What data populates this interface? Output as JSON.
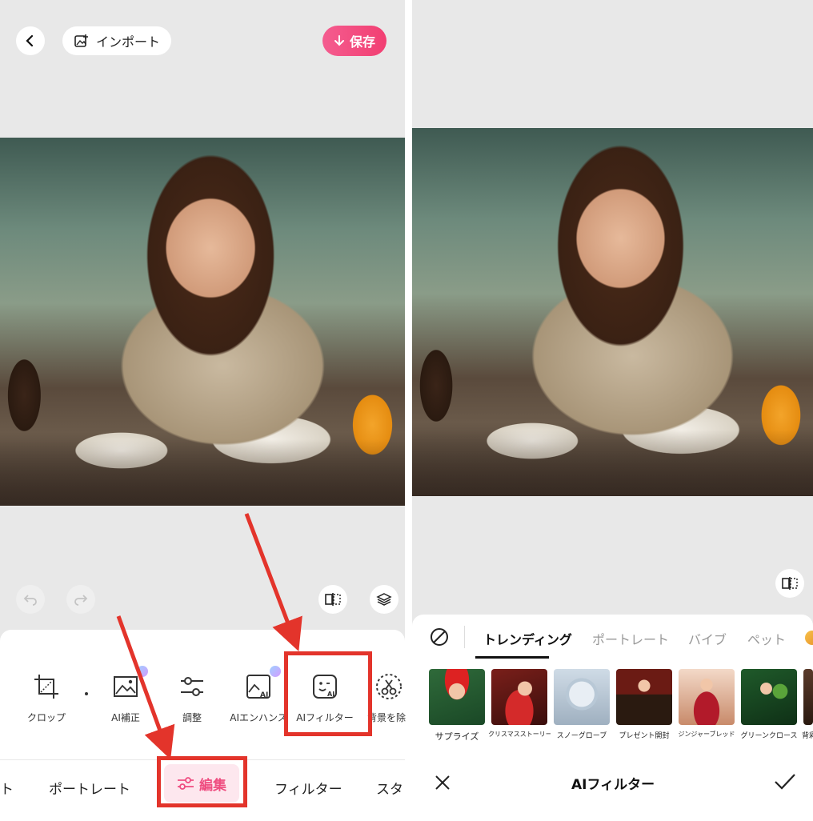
{
  "left": {
    "top_bar": {
      "back_icon": "chevron-left-icon",
      "import_label": "インポート",
      "import_icon": "image-add-icon",
      "save_label": "保存",
      "save_icon": "download-arrow-icon"
    },
    "toolbar_icons": [
      "undo-icon",
      "redo-icon",
      "compare-icon",
      "layers-icon"
    ],
    "tools": [
      {
        "label": "クロップ",
        "icon": "crop-icon"
      },
      {
        "label": "AI補正",
        "icon": "ai-image-icon"
      },
      {
        "label": "調整",
        "icon": "sliders-icon"
      },
      {
        "label": "AIエンハンス",
        "icon": "ai-enhance-icon"
      },
      {
        "label": "AIフィルター",
        "icon": "ai-filter-face-icon"
      },
      {
        "label": "背景を除",
        "icon": "scissors-icon"
      }
    ],
    "nav": {
      "partial_left": "ト",
      "portrait": "ポートレート",
      "edit": "編集",
      "filter": "フィルター",
      "partial_right": "スタ"
    }
  },
  "right": {
    "tabs": [
      "トレンディング",
      "ポートレート",
      "バイブ",
      "ペット"
    ],
    "active_tab": "トレンディング",
    "filters": [
      {
        "label": "サプライズ"
      },
      {
        "label": "クリスマスストーリー"
      },
      {
        "label": "スノーグローブ"
      },
      {
        "label": "プレゼント開封"
      },
      {
        "label": "ジンジャーブレッド"
      },
      {
        "label": "グリーンクロース"
      },
      {
        "label": "背彩"
      }
    ],
    "footer": {
      "cancel_icon": "close-icon",
      "title": "AIフィルター",
      "confirm_icon": "check-icon"
    }
  },
  "colors": {
    "accent": "#ef4d80",
    "highlight": "#e3342b",
    "panel_bg": "#e8e8e8"
  }
}
